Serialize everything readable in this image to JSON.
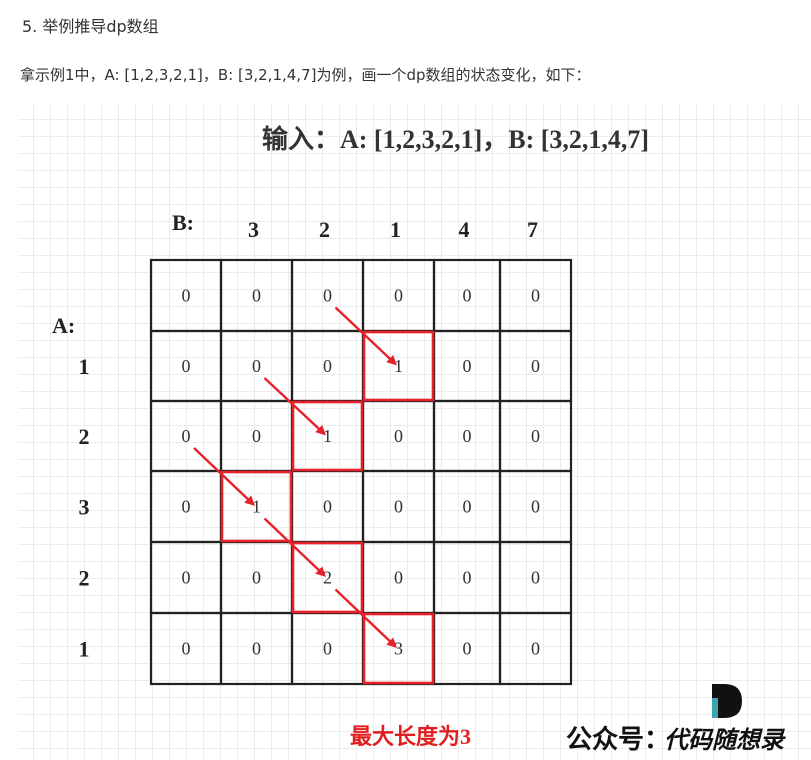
{
  "section_heading": "5. 举例推导dp数组",
  "intro_text": "拿示例1中，A: [1,2,3,2,1]，B: [3,2,1,4,7]为例，画一个dp数组的状态变化，如下：",
  "figure": {
    "title": "输入：A: [1,2,3,2,1]，B: [3,2,1,4,7]",
    "b_label": "B:",
    "a_label": "A:",
    "b_values": [
      "3",
      "2",
      "1",
      "4",
      "7"
    ],
    "a_values": [
      "1",
      "2",
      "3",
      "2",
      "1"
    ],
    "grid": [
      [
        "0",
        "0",
        "0",
        "0",
        "0",
        "0"
      ],
      [
        "0",
        "0",
        "0",
        "1",
        "0",
        "0"
      ],
      [
        "0",
        "0",
        "1",
        "0",
        "0",
        "0"
      ],
      [
        "0",
        "1",
        "0",
        "0",
        "0",
        "0"
      ],
      [
        "0",
        "0",
        "2",
        "0",
        "0",
        "0"
      ],
      [
        "0",
        "0",
        "0",
        "3",
        "0",
        "0"
      ]
    ],
    "highlighted_cells": [
      [
        1,
        3
      ],
      [
        2,
        2
      ],
      [
        3,
        1
      ],
      [
        4,
        2
      ],
      [
        5,
        3
      ]
    ],
    "arrows": [
      [
        0,
        2,
        1,
        3
      ],
      [
        1,
        1,
        2,
        2
      ],
      [
        2,
        0,
        3,
        1
      ],
      [
        3,
        1,
        4,
        2
      ],
      [
        4,
        2,
        5,
        3
      ]
    ],
    "result_text": "最大长度为3",
    "brand_prefix": "公众号：",
    "brand_name": "代码随想录",
    "highlight_color": "#e8202a",
    "arrow_color": "#e8202a",
    "logo_color": "#111111",
    "logo_accent": "#3aa6b0"
  }
}
